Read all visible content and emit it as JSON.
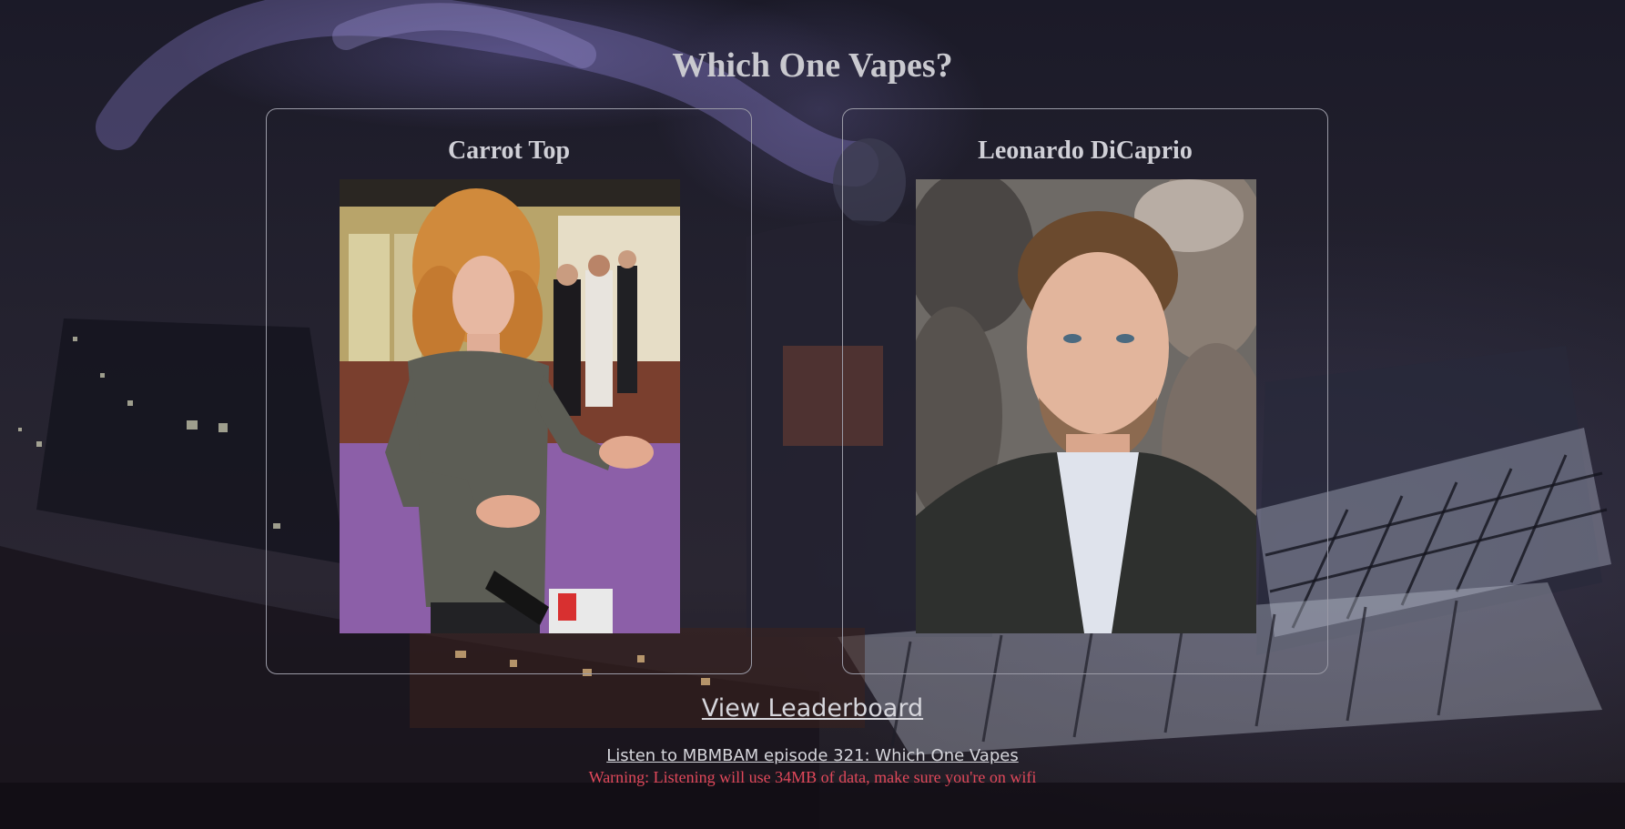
{
  "page": {
    "title": "Which One Vapes?"
  },
  "choices": [
    {
      "name": "Carrot Top"
    },
    {
      "name": "Leonardo DiCaprio"
    }
  ],
  "links": {
    "leaderboard": "View Leaderboard",
    "listen": "Listen to MBMBAM episode 321: Which One Vapes"
  },
  "warning": "Warning: Listening will use 34MB of data, make sure you're on wifi",
  "colors": {
    "background": "#1e1d2b",
    "text": "#c9c9cf",
    "card_border": "#9a9aa6",
    "warning": "#e0485a"
  }
}
